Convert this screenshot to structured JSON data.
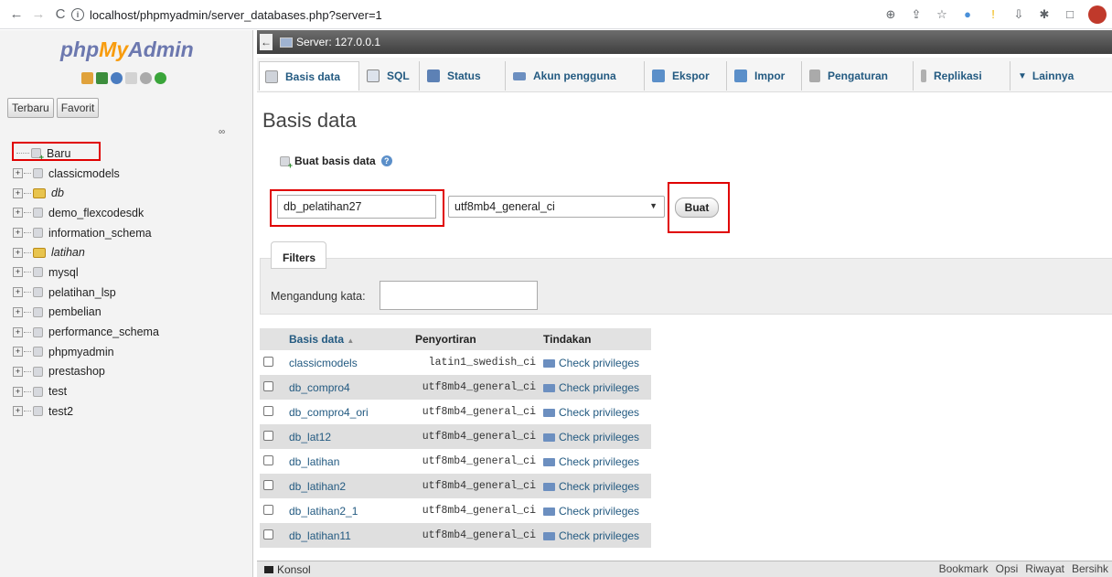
{
  "browser": {
    "url": "localhost/phpmyadmin/server_databases.php?server=1"
  },
  "sidebar": {
    "logo": {
      "php": "php",
      "my": "My",
      "admin": "Admin"
    },
    "recent_label": "Terbaru",
    "favorite_label": "Favorit",
    "items": [
      {
        "label": "Baru",
        "type": "new"
      },
      {
        "label": "classicmodels",
        "type": "db"
      },
      {
        "label": "db",
        "type": "group"
      },
      {
        "label": "demo_flexcodesdk",
        "type": "db"
      },
      {
        "label": "information_schema",
        "type": "db"
      },
      {
        "label": "latihan",
        "type": "group"
      },
      {
        "label": "mysql",
        "type": "db"
      },
      {
        "label": "pelatihan_lsp",
        "type": "db"
      },
      {
        "label": "pembelian",
        "type": "db"
      },
      {
        "label": "performance_schema",
        "type": "db"
      },
      {
        "label": "phpmyadmin",
        "type": "db"
      },
      {
        "label": "prestashop",
        "type": "db"
      },
      {
        "label": "test",
        "type": "db"
      },
      {
        "label": "test2",
        "type": "db"
      }
    ]
  },
  "server": {
    "label": "Server: 127.0.0.1"
  },
  "tabs": [
    {
      "label": "Basis data",
      "active": true
    },
    {
      "label": "SQL"
    },
    {
      "label": "Status"
    },
    {
      "label": "Akun pengguna"
    },
    {
      "label": "Ekspor"
    },
    {
      "label": "Impor"
    },
    {
      "label": "Pengaturan"
    },
    {
      "label": "Replikasi"
    },
    {
      "label": "Lainnya"
    }
  ],
  "main": {
    "heading": "Basis data",
    "create_label": "Buat basis data",
    "db_name_value": "db_pelatihan27",
    "collation_value": "utf8mb4_general_ci",
    "create_button": "Buat",
    "filters_title": "Filters",
    "filter_label": "Mengandung kata:"
  },
  "table": {
    "headers": {
      "name": "Basis data",
      "collation": "Penyortiran",
      "action": "Tindakan"
    },
    "rows": [
      {
        "name": "classicmodels",
        "collation": "latin1_swedish_ci",
        "action": "Check privileges"
      },
      {
        "name": "db_compro4",
        "collation": "utf8mb4_general_ci",
        "action": "Check privileges"
      },
      {
        "name": "db_compro4_ori",
        "collation": "utf8mb4_general_ci",
        "action": "Check privileges"
      },
      {
        "name": "db_lat12",
        "collation": "utf8mb4_general_ci",
        "action": "Check privileges"
      },
      {
        "name": "db_latihan",
        "collation": "utf8mb4_general_ci",
        "action": "Check privileges"
      },
      {
        "name": "db_latihan2",
        "collation": "utf8mb4_general_ci",
        "action": "Check privileges"
      },
      {
        "name": "db_latihan2_1",
        "collation": "utf8mb4_general_ci",
        "action": "Check privileges"
      },
      {
        "name": "db_latihan11",
        "collation": "utf8mb4_general_ci",
        "action": "Check privileges"
      }
    ]
  },
  "bottombar": {
    "console": "Konsol",
    "bookmark": "Bookmark",
    "options": "Opsi",
    "history": "Riwayat",
    "clear": "Bersihk"
  },
  "colors": {
    "link": "#235a81",
    "highlight": "#e00000",
    "logo_blue": "#6c78af",
    "logo_orange": "#f89c0e"
  }
}
